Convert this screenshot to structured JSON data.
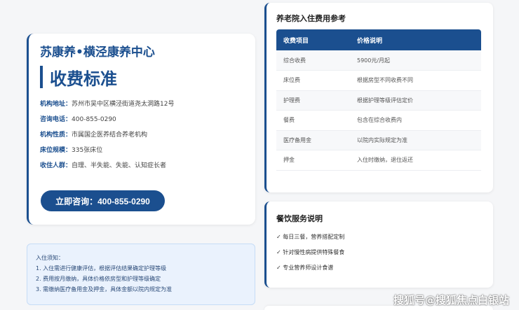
{
  "info": {
    "org_name": "苏康养•横泾康养中心",
    "page_title": "收费标准",
    "details": [
      {
        "label": "机构地址：",
        "value": "苏州市吴中区横泾街道尧太洞路12号"
      },
      {
        "label": "咨询电话：",
        "value": "400-855-0290"
      },
      {
        "label": "机构性质：",
        "value": "市属国企医养结合养老机构"
      },
      {
        "label": "床位规模：",
        "value": "335张床位"
      },
      {
        "label": "收住人群：",
        "value": "自理、半失能、失能、认知症长者"
      }
    ],
    "consult_button": "立即咨询：400-855-0290"
  },
  "notice": {
    "heading": "入住须知：",
    "items": [
      "1. 入住需进行健康评估，根据评估结果确定护理等级",
      "2. 费用按月缴纳，具体价格依房型和护理等级确定",
      "3. 需缴纳医疗备用金及押金，具体金额以院内规定为准"
    ]
  },
  "fees": {
    "title": "养老院入住费用参考",
    "headers": [
      "收费项目",
      "价格说明"
    ],
    "rows": [
      {
        "item": "综合收费",
        "desc": "5900元/月起"
      },
      {
        "item": "床位费",
        "desc": "根据房型不同收费不同"
      },
      {
        "item": "护理费",
        "desc": "根据护理等级评估定价"
      },
      {
        "item": "餐费",
        "desc": "包含在综合收费内"
      },
      {
        "item": "医疗备用金",
        "desc": "以院内实际规定为准"
      },
      {
        "item": "押金",
        "desc": "入住时缴纳，退住返还"
      }
    ]
  },
  "dining": {
    "title": "餐饮服务说明",
    "items": [
      "✓ 每日三餐，营养搭配定制",
      "✓ 针对慢性病提供特殊餐食",
      "✓ 专业营养师设计食谱"
    ]
  },
  "watermark": "搜狐号@搜狐焦点白银站",
  "colors": {
    "accent": "#1b4f8f",
    "notice_bg": "#eaf2fd"
  }
}
